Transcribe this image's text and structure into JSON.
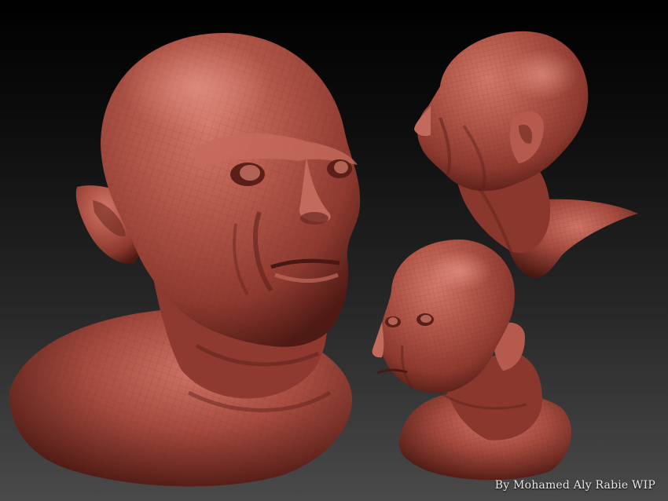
{
  "scene": {
    "subject": "sculpted-head-renders",
    "views": [
      "front-three-quarter",
      "profile-left-top",
      "three-quarter-small"
    ],
    "colors": {
      "clay": "#a0463c",
      "clay_light": "#c56a5b",
      "clay_dark": "#4e1a14",
      "background_top": "#000000",
      "background_bottom": "#4a4a4a"
    }
  },
  "caption": "By Mohamed Aly Rabie WIP"
}
